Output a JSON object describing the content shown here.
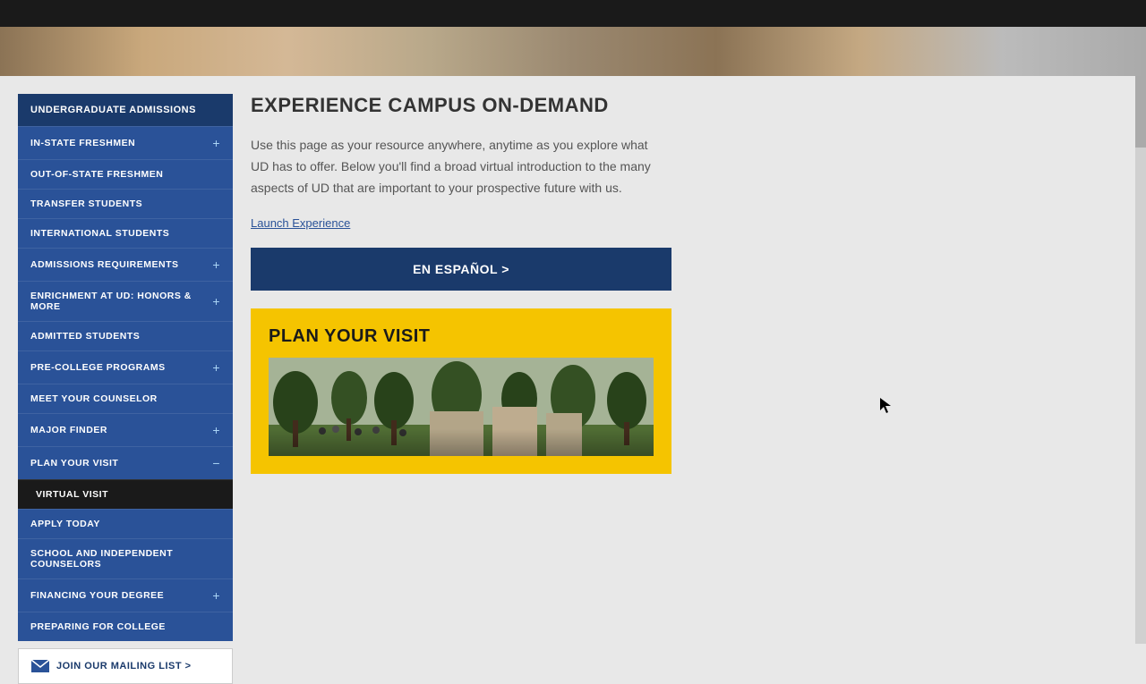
{
  "topBar": {
    "visible": true
  },
  "sidebar": {
    "title": "UNDERGRADUATE ADMISSIONS",
    "items": [
      {
        "label": "IN-STATE FRESHMEN",
        "hasPlus": true,
        "expanded": false,
        "active": false
      },
      {
        "label": "OUT-OF-STATE FRESHMEN",
        "hasPlus": false,
        "expanded": false,
        "active": false
      },
      {
        "label": "TRANSFER STUDENTS",
        "hasPlus": false,
        "expanded": false,
        "active": false
      },
      {
        "label": "INTERNATIONAL STUDENTS",
        "hasPlus": false,
        "expanded": false,
        "active": false
      },
      {
        "label": "ADMISSIONS REQUIREMENTS",
        "hasPlus": true,
        "expanded": false,
        "active": false
      },
      {
        "label": "ENRICHMENT AT UD: HONORS & MORE",
        "hasPlus": true,
        "expanded": false,
        "active": false
      },
      {
        "label": "ADMITTED STUDENTS",
        "hasPlus": false,
        "expanded": false,
        "active": false
      },
      {
        "label": "PRE-COLLEGE PROGRAMS",
        "hasPlus": true,
        "expanded": false,
        "active": false
      },
      {
        "label": "MEET YOUR COUNSELOR",
        "hasPlus": false,
        "expanded": false,
        "active": false
      },
      {
        "label": "MAJOR FINDER",
        "hasPlus": true,
        "expanded": false,
        "active": false
      },
      {
        "label": "PLAN YOUR VISIT",
        "hasMinus": true,
        "expanded": true,
        "active": false
      },
      {
        "label": "VIRTUAL VISIT",
        "isSubItem": true,
        "highlighted": true,
        "active": true
      },
      {
        "label": "APPLY TODAY",
        "hasPlus": false,
        "expanded": false,
        "active": false
      },
      {
        "label": "SCHOOL AND INDEPENDENT COUNSELORS",
        "hasPlus": false,
        "expanded": false,
        "active": false
      },
      {
        "label": "FINANCING YOUR DEGREE",
        "hasPlus": true,
        "expanded": false,
        "active": false
      },
      {
        "label": "PREPARING FOR COLLEGE",
        "hasPlus": false,
        "expanded": false,
        "active": false
      }
    ],
    "mailingListBtn": "JOIN OUR MAILING LIST >"
  },
  "content": {
    "title": "EXPERIENCE CAMPUS ON-DEMAND",
    "description": "Use this page as your resource anywhere, anytime as you explore what UD has to offer. Below you'll find a broad virtual introduction to the many aspects of UD that are important to your prospective future with us.",
    "launchLink": "Launch Experience",
    "espanolBtn": "EN ESPAÑOL >",
    "planVisit": {
      "title": "PLAN YOUR VISIT"
    }
  }
}
